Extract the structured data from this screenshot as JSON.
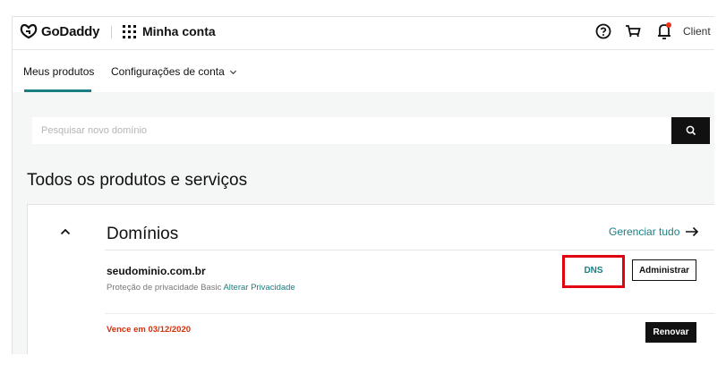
{
  "header": {
    "brand": "GoDaddy",
    "account_label": "Minha conta",
    "client_label": "Client",
    "notification_dot_color": "#e8331c"
  },
  "tabs": [
    {
      "label": "Meus produtos",
      "active": true
    },
    {
      "label": "Configurações de conta",
      "active": false
    }
  ],
  "search": {
    "placeholder": "Pesquisar novo domínio"
  },
  "section_title": "Todos os produtos e serviços",
  "domains_card": {
    "title": "Domínios",
    "manage_all_label": "Gerenciar tudo",
    "domain": {
      "name": "seudominio.com.br",
      "privacy_text": "Proteção de privacidade Basic",
      "privacy_link": "Alterar Privacidade",
      "dns_label": "DNS",
      "admin_label": "Administrar",
      "expires_text": "Vence em 03/12/2020",
      "renew_label": "Renovar"
    }
  },
  "colors": {
    "accent": "#1a7e82",
    "highlight_box": "#e00010",
    "expire_red": "#d4300c"
  }
}
